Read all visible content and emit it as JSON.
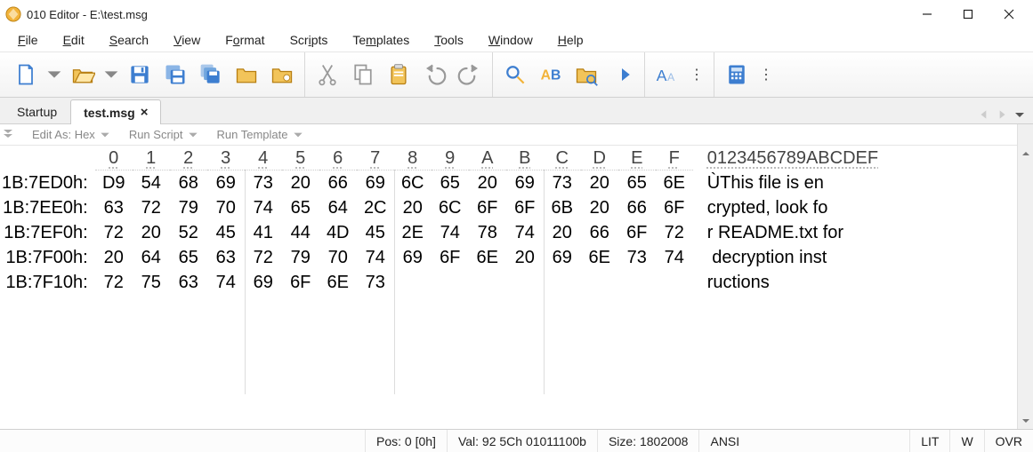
{
  "window": {
    "title": "010 Editor - E:\\test.msg"
  },
  "menu": {
    "file": {
      "pre": "",
      "u": "F",
      "post": "ile"
    },
    "edit": {
      "pre": "",
      "u": "E",
      "post": "dit"
    },
    "search": {
      "pre": "",
      "u": "S",
      "post": "earch"
    },
    "view": {
      "pre": "",
      "u": "V",
      "post": "iew"
    },
    "format": {
      "pre": "F",
      "u": "o",
      "post": "rmat"
    },
    "scripts": {
      "pre": "Scr",
      "u": "i",
      "post": "pts"
    },
    "templates": {
      "pre": "Te",
      "u": "m",
      "post": "plates"
    },
    "tools": {
      "pre": "",
      "u": "T",
      "post": "ools"
    },
    "window": {
      "pre": "",
      "u": "W",
      "post": "indow"
    },
    "help": {
      "pre": "",
      "u": "H",
      "post": "elp"
    }
  },
  "tabs": {
    "startup": "Startup",
    "active": "test.msg"
  },
  "optbar": {
    "edit_as": "Edit As: Hex",
    "run_script": "Run Script",
    "run_template": "Run Template"
  },
  "hex": {
    "col_headers": [
      "0",
      "1",
      "2",
      "3",
      "4",
      "5",
      "6",
      "7",
      "8",
      "9",
      "A",
      "B",
      "C",
      "D",
      "E",
      "F"
    ],
    "ascii_header": "0123456789ABCDEF",
    "rows": [
      {
        "offset": "1B:7ED0h:",
        "bytes": [
          "D9",
          "54",
          "68",
          "69",
          "73",
          "20",
          "66",
          "69",
          "6C",
          "65",
          "20",
          "69",
          "73",
          "20",
          "65",
          "6E"
        ],
        "ascii": "ÙThis file is en"
      },
      {
        "offset": "1B:7EE0h:",
        "bytes": [
          "63",
          "72",
          "79",
          "70",
          "74",
          "65",
          "64",
          "2C",
          "20",
          "6C",
          "6F",
          "6F",
          "6B",
          "20",
          "66",
          "6F"
        ],
        "ascii": "crypted, look fo"
      },
      {
        "offset": "1B:7EF0h:",
        "bytes": [
          "72",
          "20",
          "52",
          "45",
          "41",
          "44",
          "4D",
          "45",
          "2E",
          "74",
          "78",
          "74",
          "20",
          "66",
          "6F",
          "72"
        ],
        "ascii": "r README.txt for"
      },
      {
        "offset": "1B:7F00h:",
        "bytes": [
          "20",
          "64",
          "65",
          "63",
          "72",
          "79",
          "70",
          "74",
          "69",
          "6F",
          "6E",
          "20",
          "69",
          "6E",
          "73",
          "74"
        ],
        "ascii": " decryption inst"
      },
      {
        "offset": "1B:7F10h:",
        "bytes": [
          "72",
          "75",
          "63",
          "74",
          "69",
          "6F",
          "6E",
          "73",
          "",
          "",
          "",
          "",
          "",
          "",
          "",
          ""
        ],
        "ascii": "ructions"
      }
    ]
  },
  "status": {
    "pos": "Pos: 0 [0h]",
    "val": "Val: 92 5Ch 01011100b",
    "size": "Size: 1802008",
    "enc": "ANSI",
    "endian": "LIT",
    "w": "W",
    "ovr": "OVR"
  },
  "colors": {
    "accent_blue": "#3d7ed0",
    "accent_yellow": "#f2b33a"
  }
}
